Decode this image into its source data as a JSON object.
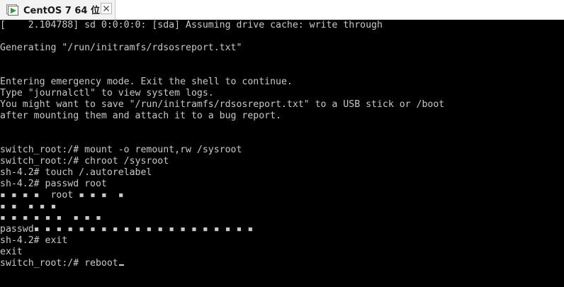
{
  "tab": {
    "title": "CentOS 7 64 位",
    "icon": "vm-play-icon",
    "close_icon": "close-icon"
  },
  "console": {
    "lines": [
      "[    2.104788] sd 0:0:0:0: [sda] Assuming drive cache: write through",
      "",
      "Generating \"/run/initramfs/rdsosreport.txt\"",
      "",
      "",
      "Entering emergency mode. Exit the shell to continue.",
      "Type \"journalctl\" to view system logs.",
      "You might want to save \"/run/initramfs/rdsosreport.txt\" to a USB stick or /boot",
      "after mounting them and attach it to a bug report.",
      "",
      "",
      "switch_root:/# mount -o remount,rw /sysroot",
      "switch_root:/# chroot /sysroot",
      "sh-4.2# touch /.autorelabel",
      "sh-4.2# passwd root",
      "▪ ▪ ▪ ▪  root ▪ ▪ ▪  ▪",
      "▪ ▪  ▪ ▪ ▪",
      "▪ ▪ ▪ ▪ ▪ ▪  ▪ ▪ ▪",
      "passwd▪ ▪ ▪ ▪ ▪ ▪ ▪ ▪ ▪ ▪ ▪ ▪ ▪ ▪ ▪ ▪ ▪ ▪ ▪ ▪",
      "sh-4.2# exit",
      "exit",
      "switch_root:/# reboot"
    ]
  },
  "colors": {
    "console_bg": "#000000",
    "console_text": "#c8c8c8",
    "tab_bg": "#f3f3f3"
  }
}
